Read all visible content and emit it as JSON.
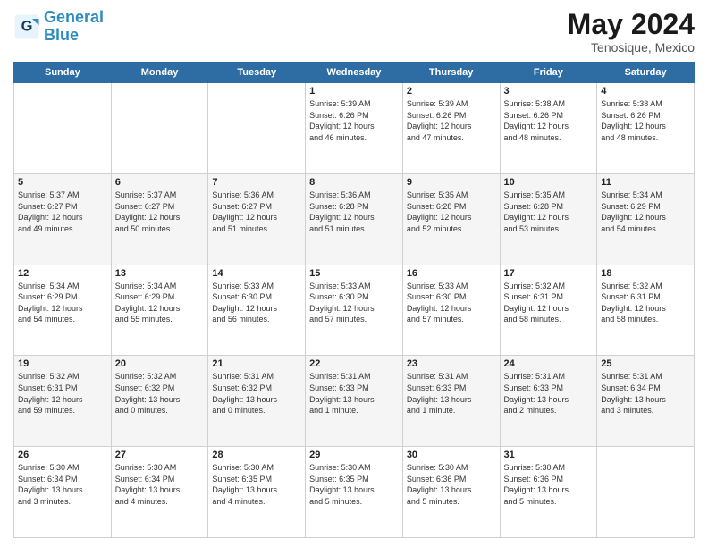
{
  "logo": {
    "line1": "General",
    "line2": "Blue"
  },
  "title": "May 2024",
  "subtitle": "Tenosique, Mexico",
  "days_header": [
    "Sunday",
    "Monday",
    "Tuesday",
    "Wednesday",
    "Thursday",
    "Friday",
    "Saturday"
  ],
  "weeks": [
    [
      {
        "day": "",
        "info": ""
      },
      {
        "day": "",
        "info": ""
      },
      {
        "day": "",
        "info": ""
      },
      {
        "day": "1",
        "info": "Sunrise: 5:39 AM\nSunset: 6:26 PM\nDaylight: 12 hours\nand 46 minutes."
      },
      {
        "day": "2",
        "info": "Sunrise: 5:39 AM\nSunset: 6:26 PM\nDaylight: 12 hours\nand 47 minutes."
      },
      {
        "day": "3",
        "info": "Sunrise: 5:38 AM\nSunset: 6:26 PM\nDaylight: 12 hours\nand 48 minutes."
      },
      {
        "day": "4",
        "info": "Sunrise: 5:38 AM\nSunset: 6:26 PM\nDaylight: 12 hours\nand 48 minutes."
      }
    ],
    [
      {
        "day": "5",
        "info": "Sunrise: 5:37 AM\nSunset: 6:27 PM\nDaylight: 12 hours\nand 49 minutes."
      },
      {
        "day": "6",
        "info": "Sunrise: 5:37 AM\nSunset: 6:27 PM\nDaylight: 12 hours\nand 50 minutes."
      },
      {
        "day": "7",
        "info": "Sunrise: 5:36 AM\nSunset: 6:27 PM\nDaylight: 12 hours\nand 51 minutes."
      },
      {
        "day": "8",
        "info": "Sunrise: 5:36 AM\nSunset: 6:28 PM\nDaylight: 12 hours\nand 51 minutes."
      },
      {
        "day": "9",
        "info": "Sunrise: 5:35 AM\nSunset: 6:28 PM\nDaylight: 12 hours\nand 52 minutes."
      },
      {
        "day": "10",
        "info": "Sunrise: 5:35 AM\nSunset: 6:28 PM\nDaylight: 12 hours\nand 53 minutes."
      },
      {
        "day": "11",
        "info": "Sunrise: 5:34 AM\nSunset: 6:29 PM\nDaylight: 12 hours\nand 54 minutes."
      }
    ],
    [
      {
        "day": "12",
        "info": "Sunrise: 5:34 AM\nSunset: 6:29 PM\nDaylight: 12 hours\nand 54 minutes."
      },
      {
        "day": "13",
        "info": "Sunrise: 5:34 AM\nSunset: 6:29 PM\nDaylight: 12 hours\nand 55 minutes."
      },
      {
        "day": "14",
        "info": "Sunrise: 5:33 AM\nSunset: 6:30 PM\nDaylight: 12 hours\nand 56 minutes."
      },
      {
        "day": "15",
        "info": "Sunrise: 5:33 AM\nSunset: 6:30 PM\nDaylight: 12 hours\nand 57 minutes."
      },
      {
        "day": "16",
        "info": "Sunrise: 5:33 AM\nSunset: 6:30 PM\nDaylight: 12 hours\nand 57 minutes."
      },
      {
        "day": "17",
        "info": "Sunrise: 5:32 AM\nSunset: 6:31 PM\nDaylight: 12 hours\nand 58 minutes."
      },
      {
        "day": "18",
        "info": "Sunrise: 5:32 AM\nSunset: 6:31 PM\nDaylight: 12 hours\nand 58 minutes."
      }
    ],
    [
      {
        "day": "19",
        "info": "Sunrise: 5:32 AM\nSunset: 6:31 PM\nDaylight: 12 hours\nand 59 minutes."
      },
      {
        "day": "20",
        "info": "Sunrise: 5:32 AM\nSunset: 6:32 PM\nDaylight: 13 hours\nand 0 minutes."
      },
      {
        "day": "21",
        "info": "Sunrise: 5:31 AM\nSunset: 6:32 PM\nDaylight: 13 hours\nand 0 minutes."
      },
      {
        "day": "22",
        "info": "Sunrise: 5:31 AM\nSunset: 6:33 PM\nDaylight: 13 hours\nand 1 minute."
      },
      {
        "day": "23",
        "info": "Sunrise: 5:31 AM\nSunset: 6:33 PM\nDaylight: 13 hours\nand 1 minute."
      },
      {
        "day": "24",
        "info": "Sunrise: 5:31 AM\nSunset: 6:33 PM\nDaylight: 13 hours\nand 2 minutes."
      },
      {
        "day": "25",
        "info": "Sunrise: 5:31 AM\nSunset: 6:34 PM\nDaylight: 13 hours\nand 3 minutes."
      }
    ],
    [
      {
        "day": "26",
        "info": "Sunrise: 5:30 AM\nSunset: 6:34 PM\nDaylight: 13 hours\nand 3 minutes."
      },
      {
        "day": "27",
        "info": "Sunrise: 5:30 AM\nSunset: 6:34 PM\nDaylight: 13 hours\nand 4 minutes."
      },
      {
        "day": "28",
        "info": "Sunrise: 5:30 AM\nSunset: 6:35 PM\nDaylight: 13 hours\nand 4 minutes."
      },
      {
        "day": "29",
        "info": "Sunrise: 5:30 AM\nSunset: 6:35 PM\nDaylight: 13 hours\nand 5 minutes."
      },
      {
        "day": "30",
        "info": "Sunrise: 5:30 AM\nSunset: 6:36 PM\nDaylight: 13 hours\nand 5 minutes."
      },
      {
        "day": "31",
        "info": "Sunrise: 5:30 AM\nSunset: 6:36 PM\nDaylight: 13 hours\nand 5 minutes."
      },
      {
        "day": "",
        "info": ""
      }
    ]
  ]
}
